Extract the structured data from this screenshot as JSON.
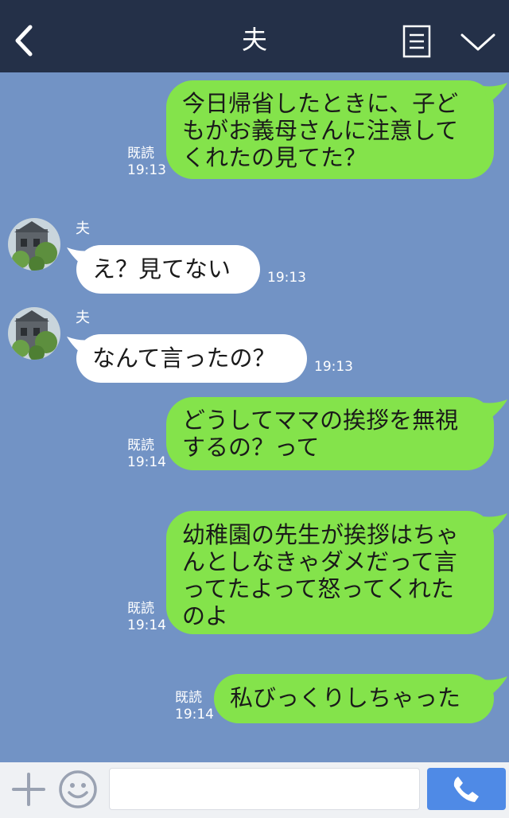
{
  "header": {
    "title": "夫",
    "back_icon": "chevron-left-icon",
    "menu_icon": "menu-icon",
    "collapse_icon": "chevron-down-icon"
  },
  "messages": [
    {
      "from": "me",
      "lines": [
        "今日帰省したときに、子ど",
        "もがお義母さんに注意して",
        "くれたの見てた？"
      ],
      "read": "既読",
      "time": "19:13"
    },
    {
      "from": "them",
      "sender": "夫",
      "lines": [
        "え？見てない"
      ],
      "time": "19:13"
    },
    {
      "from": "them",
      "sender": "夫",
      "lines": [
        "なんて言ったの？"
      ],
      "time": "19:13"
    },
    {
      "from": "me",
      "lines": [
        "どうしてママの挨拶を無視",
        "するの？って"
      ],
      "read": "既読",
      "time": "19:14"
    },
    {
      "from": "me",
      "lines": [
        "幼稚園の先生が挨拶はちゃ",
        "んとしなきゃダメだって言",
        "ってたよって怒ってくれた",
        "のよ"
      ],
      "read": "既読",
      "time": "19:14"
    },
    {
      "from": "me",
      "lines": [
        "私びっくりしちゃった"
      ],
      "read": "既読",
      "time": "19:14"
    }
  ],
  "footer": {
    "add_icon": "plus-icon",
    "emoji_icon": "smiley-icon",
    "input_placeholder": "",
    "call_icon": "phone-icon"
  },
  "colors": {
    "background": "#7293c5",
    "header": "#243048",
    "outgoing_bubble": "#84e34b",
    "incoming_bubble": "#ffffff",
    "call_button": "#4f8ae6"
  }
}
